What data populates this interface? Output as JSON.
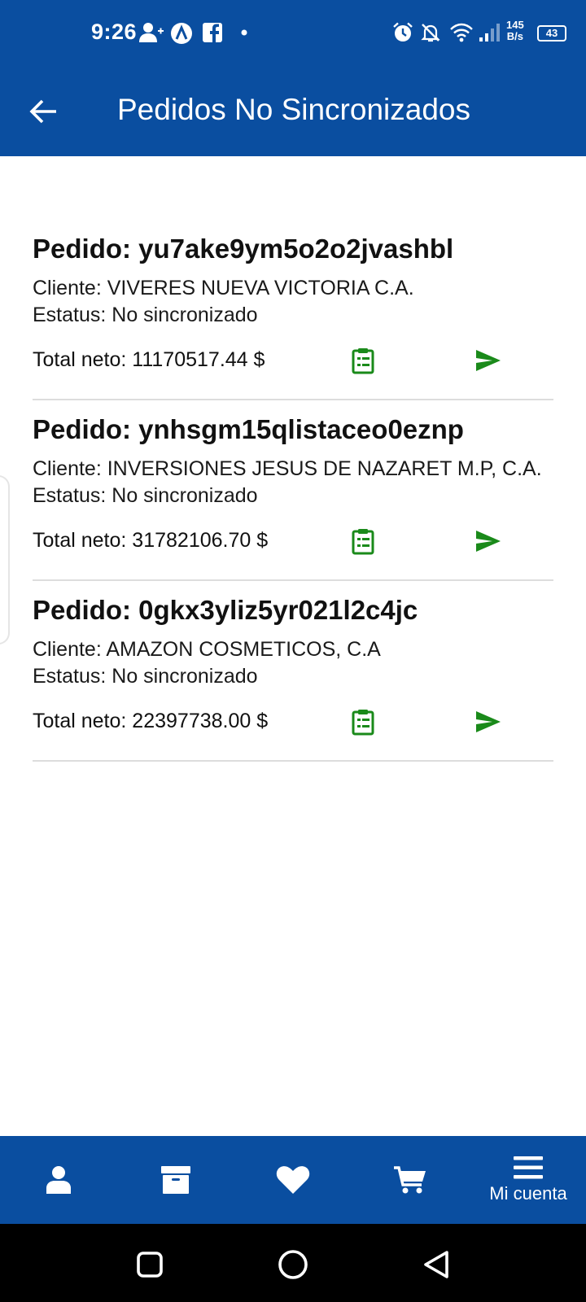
{
  "status_bar": {
    "time": "9:26",
    "net_speed_value": "145",
    "net_speed_unit": "B/s",
    "battery": "43",
    "icons": [
      "person-add-icon",
      "app-a-icon",
      "facebook-icon",
      "dot-icon",
      "alarm-icon",
      "bell-off-icon",
      "wifi-icon",
      "signal-icon",
      "battery-icon"
    ]
  },
  "header": {
    "title": "Pedidos No Sincronizados",
    "back_icon": "arrow-left-icon",
    "background": "#0a4ea0"
  },
  "orders": [
    {
      "title": "Pedido: yu7ake9ym5o2o2jvashbl",
      "client": "Cliente: VIVERES NUEVA VICTORIA C.A.",
      "status": "Estatus: No sincronizado",
      "total": "Total neto: 11170517.44 $"
    },
    {
      "title": "Pedido: ynhsgm15qlistaceo0eznp",
      "client": "Cliente: INVERSIONES JESUS DE NAZARET M.P, C.A.",
      "status": "Estatus: No sincronizado",
      "total": "Total neto: 31782106.70 $"
    },
    {
      "title": "Pedido: 0gkx3yliz5yr021l2c4jc",
      "client": "Cliente: AMAZON COSMETICOS, C.A",
      "status": "Estatus: No sincronizado",
      "total": "Total neto: 22397738.00 $"
    }
  ],
  "order_actions": {
    "detail_icon": "clipboard-list-icon",
    "send_icon": "send-icon",
    "icon_color": "#1a8a1a"
  },
  "bottom_nav": {
    "items": [
      {
        "icon": "user-icon"
      },
      {
        "icon": "archive-box-icon"
      },
      {
        "icon": "heart-icon"
      },
      {
        "icon": "cart-icon"
      },
      {
        "icon": "menu-icon",
        "label": "Mi cuenta"
      }
    ],
    "background": "#0a4ea0"
  },
  "system_nav": {
    "icons": [
      "recents-square-icon",
      "home-circle-icon",
      "back-triangle-icon"
    ]
  }
}
